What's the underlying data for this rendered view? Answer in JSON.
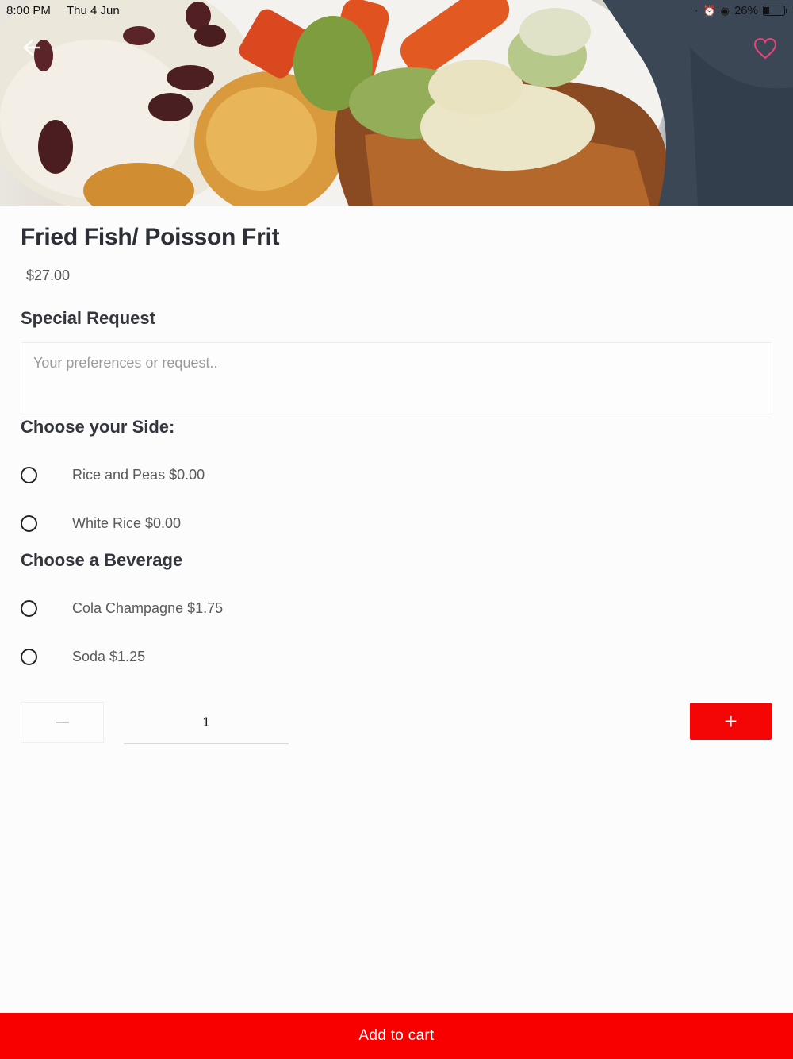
{
  "status_bar": {
    "time": "8:00 PM",
    "date": "Thu 4 Jun",
    "battery": "26%",
    "battery_level": 0.26
  },
  "hero": {
    "image_icon": "fried-fish-meal-photo",
    "back_icon": "arrow-left-icon",
    "favorite_icon": "heart-outline-icon"
  },
  "product": {
    "title": "Fried Fish/ Poisson Frit",
    "price": "$27.00"
  },
  "special_request": {
    "heading": "Special Request",
    "placeholder": "Your preferences or request..",
    "value": ""
  },
  "side": {
    "heading": "Choose your Side:",
    "options": [
      {
        "label": "Rice and Peas $0.00"
      },
      {
        "label": "White Rice $0.00"
      }
    ]
  },
  "beverage": {
    "heading": "Choose a Beverage",
    "options": [
      {
        "label": "Cola Champagne $1.75"
      },
      {
        "label": "Soda $1.25"
      }
    ]
  },
  "quantity": {
    "value": "1",
    "plus_label": "+"
  },
  "cart": {
    "button_label": "Add to cart"
  },
  "colors": {
    "accent": "#f80000",
    "favorite": "#e8447a"
  }
}
